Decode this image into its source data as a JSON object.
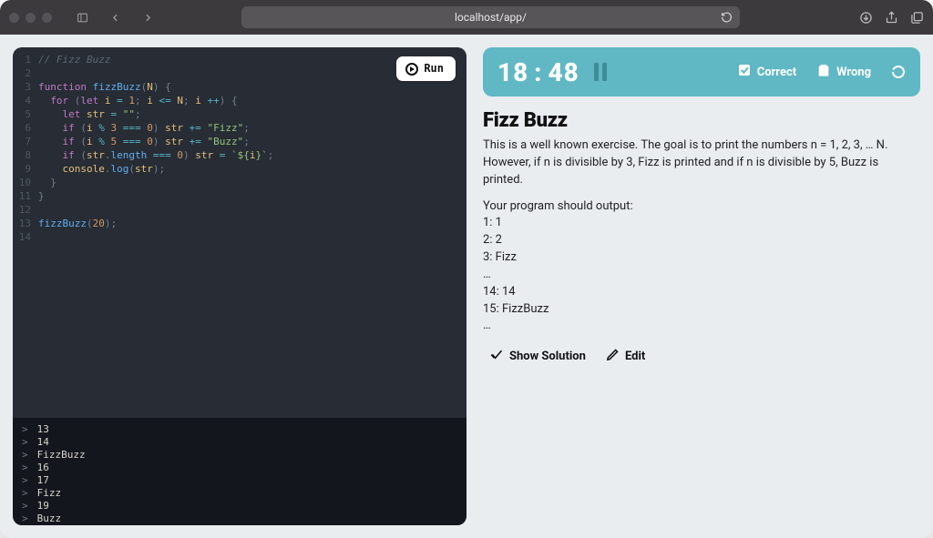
{
  "browser": {
    "url": "localhost/app/"
  },
  "editor": {
    "run_label": "Run",
    "line_count": 14,
    "code_tokens": [
      [
        [
          "c-comment",
          "// Fizz Buzz"
        ]
      ],
      [],
      [
        [
          "c-kw",
          "function"
        ],
        [
          "c-def",
          " "
        ],
        [
          "c-fn",
          "fizzBuzz"
        ],
        [
          "c-p",
          "("
        ],
        [
          "c-id",
          "N"
        ],
        [
          "c-p",
          ") {"
        ]
      ],
      [
        [
          "c-def",
          "  "
        ],
        [
          "c-kw",
          "for"
        ],
        [
          "c-def",
          " "
        ],
        [
          "c-p",
          "("
        ],
        [
          "c-kw",
          "let"
        ],
        [
          "c-def",
          " "
        ],
        [
          "c-id",
          "i"
        ],
        [
          "c-def",
          " "
        ],
        [
          "c-op",
          "="
        ],
        [
          "c-def",
          " "
        ],
        [
          "c-num",
          "1"
        ],
        [
          "c-p",
          "; "
        ],
        [
          "c-id",
          "i"
        ],
        [
          "c-def",
          " "
        ],
        [
          "c-op",
          "<="
        ],
        [
          "c-def",
          " "
        ],
        [
          "c-id",
          "N"
        ],
        [
          "c-p",
          "; "
        ],
        [
          "c-id",
          "i"
        ],
        [
          "c-def",
          " "
        ],
        [
          "c-op",
          "++"
        ],
        [
          "c-p",
          ") {"
        ]
      ],
      [
        [
          "c-def",
          "    "
        ],
        [
          "c-kw",
          "let"
        ],
        [
          "c-def",
          " "
        ],
        [
          "c-id",
          "str"
        ],
        [
          "c-def",
          " "
        ],
        [
          "c-op",
          "="
        ],
        [
          "c-def",
          " "
        ],
        [
          "c-str",
          "\"\""
        ],
        [
          "c-p",
          ";"
        ]
      ],
      [
        [
          "c-def",
          "    "
        ],
        [
          "c-kw",
          "if"
        ],
        [
          "c-def",
          " "
        ],
        [
          "c-p",
          "("
        ],
        [
          "c-id",
          "i"
        ],
        [
          "c-def",
          " "
        ],
        [
          "c-op",
          "%"
        ],
        [
          "c-def",
          " "
        ],
        [
          "c-num",
          "3"
        ],
        [
          "c-def",
          " "
        ],
        [
          "c-op",
          "==="
        ],
        [
          "c-def",
          " "
        ],
        [
          "c-num",
          "0"
        ],
        [
          "c-p",
          ") "
        ],
        [
          "c-id",
          "str"
        ],
        [
          "c-def",
          " "
        ],
        [
          "c-op",
          "+="
        ],
        [
          "c-def",
          " "
        ],
        [
          "c-str",
          "\"Fizz\""
        ],
        [
          "c-p",
          ";"
        ]
      ],
      [
        [
          "c-def",
          "    "
        ],
        [
          "c-kw",
          "if"
        ],
        [
          "c-def",
          " "
        ],
        [
          "c-p",
          "("
        ],
        [
          "c-id",
          "i"
        ],
        [
          "c-def",
          " "
        ],
        [
          "c-op",
          "%"
        ],
        [
          "c-def",
          " "
        ],
        [
          "c-num",
          "5"
        ],
        [
          "c-def",
          " "
        ],
        [
          "c-op",
          "==="
        ],
        [
          "c-def",
          " "
        ],
        [
          "c-num",
          "0"
        ],
        [
          "c-p",
          ") "
        ],
        [
          "c-id",
          "str"
        ],
        [
          "c-def",
          " "
        ],
        [
          "c-op",
          "+="
        ],
        [
          "c-def",
          " "
        ],
        [
          "c-str",
          "\"Buzz\""
        ],
        [
          "c-p",
          ";"
        ]
      ],
      [
        [
          "c-def",
          "    "
        ],
        [
          "c-kw",
          "if"
        ],
        [
          "c-def",
          " "
        ],
        [
          "c-p",
          "("
        ],
        [
          "c-id",
          "str"
        ],
        [
          "c-p",
          "."
        ],
        [
          "c-fn",
          "length"
        ],
        [
          "c-def",
          " "
        ],
        [
          "c-op",
          "==="
        ],
        [
          "c-def",
          " "
        ],
        [
          "c-num",
          "0"
        ],
        [
          "c-p",
          ") "
        ],
        [
          "c-id",
          "str"
        ],
        [
          "c-def",
          " "
        ],
        [
          "c-op",
          "="
        ],
        [
          "c-def",
          " "
        ],
        [
          "c-str",
          "`${"
        ],
        [
          "c-id",
          "i"
        ],
        [
          "c-str",
          "}`"
        ],
        [
          "c-p",
          ";"
        ]
      ],
      [
        [
          "c-def",
          "    "
        ],
        [
          "c-id",
          "console"
        ],
        [
          "c-p",
          "."
        ],
        [
          "c-fn",
          "log"
        ],
        [
          "c-p",
          "("
        ],
        [
          "c-id",
          "str"
        ],
        [
          "c-p",
          ");"
        ]
      ],
      [
        [
          "c-def",
          "  "
        ],
        [
          "c-p",
          "}"
        ]
      ],
      [
        [
          "c-p",
          "}"
        ]
      ],
      [],
      [
        [
          "c-fn",
          "fizzBuzz"
        ],
        [
          "c-p",
          "("
        ],
        [
          "c-num",
          "20"
        ],
        [
          "c-p",
          ");"
        ]
      ],
      []
    ]
  },
  "console": {
    "lines": [
      "13",
      "14",
      "FizzBuzz",
      "16",
      "17",
      "Fizz",
      "19",
      "Buzz"
    ]
  },
  "timer": {
    "minutes": "18",
    "seconds": "48",
    "correct_label": "Correct",
    "wrong_label": "Wrong"
  },
  "problem": {
    "title": "Fizz Buzz",
    "description": "This is a well known exercise. The goal is to print the numbers n = 1, 2, 3, … N. However, if n is divisible by 3, Fizz is printed and if n is divisible by 5, Buzz is printed.",
    "output_intro": "Your program should output:",
    "output_lines": [
      "1: 1",
      "2: 2",
      "3: Fizz",
      "…",
      "14: 14",
      "15: FizzBuzz",
      "…"
    ],
    "show_solution_label": "Show Solution",
    "edit_label": "Edit"
  }
}
